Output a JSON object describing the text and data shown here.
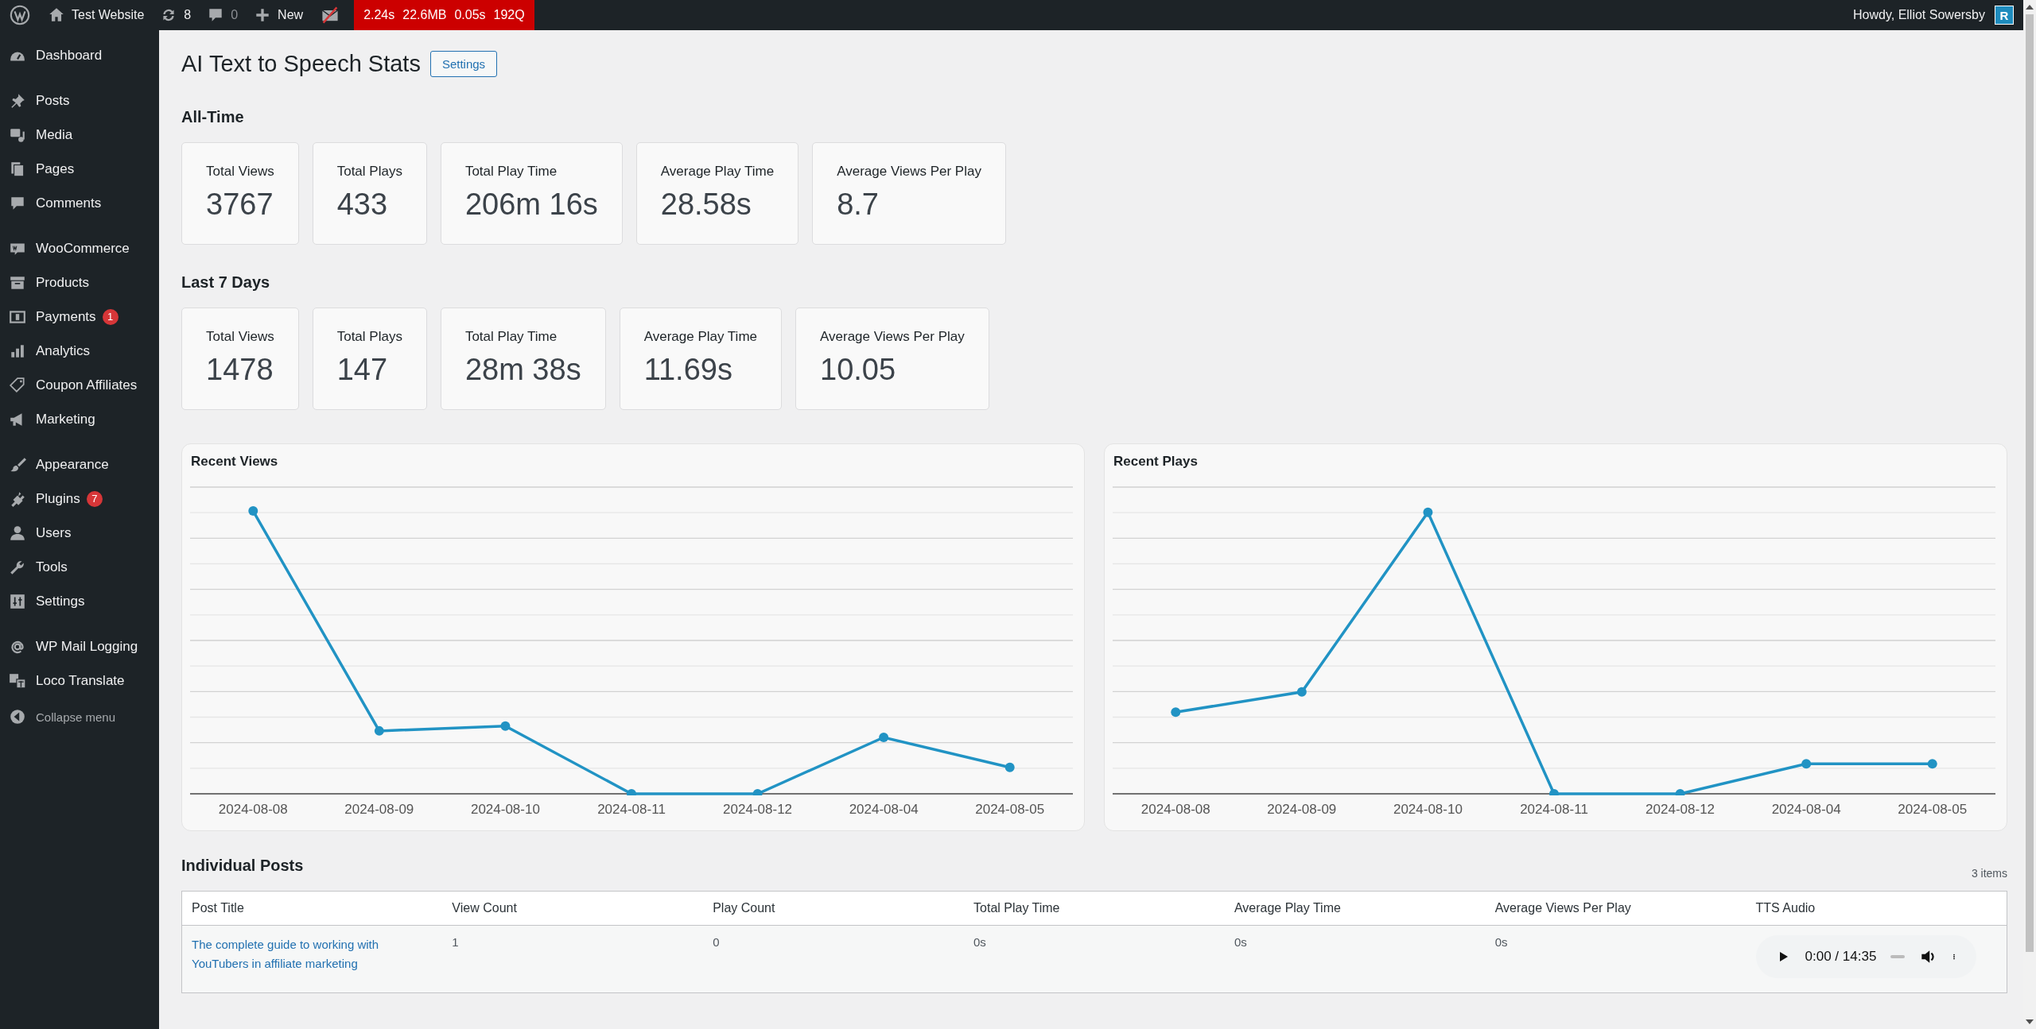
{
  "admin_bar": {
    "site_name": "Test Website",
    "updates": "8",
    "comments": "0",
    "new_label": "New",
    "perf": [
      "2.24s",
      "22.6MB",
      "0.05s",
      "192Q"
    ],
    "greeting": "Howdy, Elliot Sowersby",
    "avatar_letter": "R"
  },
  "sidebar": {
    "groups": [
      {
        "items": [
          {
            "label": "Dashboard",
            "selected": false
          }
        ]
      },
      {
        "items": [
          {
            "label": "Posts",
            "selected": false
          },
          {
            "label": "Media",
            "selected": false
          },
          {
            "label": "Pages",
            "selected": false
          },
          {
            "label": "Comments",
            "selected": false
          }
        ]
      },
      {
        "items": [
          {
            "label": "WooCommerce",
            "selected": false
          },
          {
            "label": "Products",
            "selected": false
          },
          {
            "label": "Payments",
            "badge": "1",
            "selected": false
          },
          {
            "label": "Analytics",
            "selected": false
          },
          {
            "label": "Coupon Affiliates",
            "selected": false
          },
          {
            "label": "Marketing",
            "selected": false
          }
        ]
      },
      {
        "items": [
          {
            "label": "Appearance",
            "selected": false
          },
          {
            "label": "Plugins",
            "badge": "7",
            "selected": false
          },
          {
            "label": "Users",
            "selected": false
          },
          {
            "label": "Tools",
            "selected": false
          },
          {
            "label": "Settings",
            "selected": false
          }
        ]
      },
      {
        "items": [
          {
            "label": "WP Mail Logging",
            "selected": false
          },
          {
            "label": "Loco Translate",
            "selected": false
          }
        ]
      }
    ],
    "collapse": "Collapse menu"
  },
  "page": {
    "title": "AI Text to Speech Stats",
    "settings_button": "Settings"
  },
  "stat_sections": [
    {
      "heading": "All-Time",
      "cards": [
        {
          "label": "Total Views",
          "value": "3767"
        },
        {
          "label": "Total Plays",
          "value": "433"
        },
        {
          "label": "Total Play Time",
          "value": "206m 16s"
        },
        {
          "label": "Average Play Time",
          "value": "28.58s"
        },
        {
          "label": "Average Views Per Play",
          "value": "8.7"
        }
      ]
    },
    {
      "heading": "Last 7 Days",
      "cards": [
        {
          "label": "Total Views",
          "value": "1478"
        },
        {
          "label": "Total Plays",
          "value": "147"
        },
        {
          "label": "Total Play Time",
          "value": "28m 38s"
        },
        {
          "label": "Average Play Time",
          "value": "11.69s"
        },
        {
          "label": "Average Views Per Play",
          "value": "10.05"
        }
      ]
    }
  ],
  "charts": [
    {
      "title": "Recent Views",
      "x_labels": [
        "2024-08-08",
        "2024-08-09",
        "2024-08-10",
        "2024-08-11",
        "2024-08-12",
        "2024-08-04",
        "2024-08-05"
      ]
    },
    {
      "title": "Recent Plays",
      "x_labels": [
        "2024-08-08",
        "2024-08-09",
        "2024-08-10",
        "2024-08-11",
        "2024-08-12",
        "2024-08-04",
        "2024-08-05"
      ]
    }
  ],
  "posts_table": {
    "heading": "Individual Posts",
    "item_count": "3 items",
    "columns": [
      "Post Title",
      "View Count",
      "Play Count",
      "Total Play Time",
      "Average Play Time",
      "Average Views Per Play",
      "TTS Audio"
    ],
    "rows": [
      {
        "cells": [
          "The complete guide to working with YouTubers in affiliate marketing",
          "1",
          "0",
          "0s",
          "0s",
          "0s"
        ],
        "audio": {
          "time": "0:00 / 14:35",
          "level": 0
        }
      }
    ]
  }
}
